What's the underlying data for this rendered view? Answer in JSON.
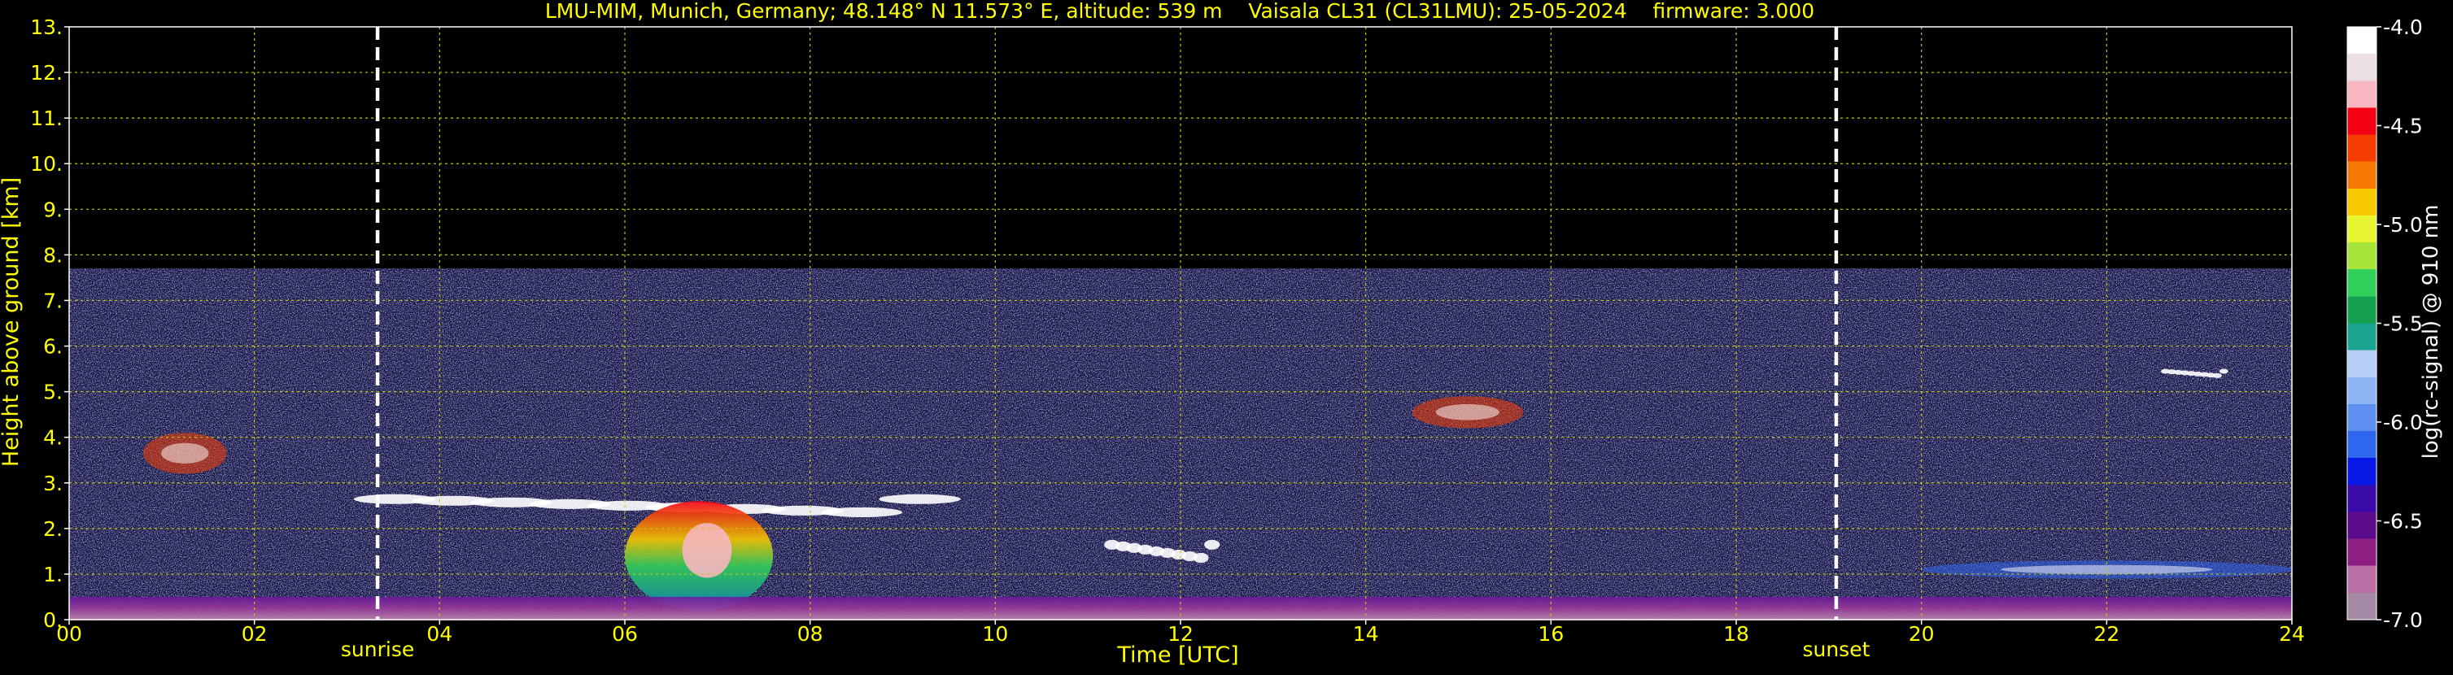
{
  "chart_data": {
    "type": "heatmap",
    "title": "LMU-MIM, Munich, Germany; 48.148° N 11.573° E, altitude: 539 m    Vaisala CL31 (CL31LMU): 25-05-2024    firmware: 3.000",
    "xlabel": "Time [UTC]",
    "ylabel": "Height above ground [km]",
    "xlim": [
      0,
      24
    ],
    "ylim": [
      0,
      13
    ],
    "x_ticks": [
      "00",
      "02",
      "04",
      "06",
      "08",
      "10",
      "12",
      "14",
      "16",
      "18",
      "20",
      "22",
      "24"
    ],
    "y_ticks": [
      "0.",
      "1.",
      "2.",
      "3.",
      "4.",
      "5.",
      "6.",
      "7.",
      "8.",
      "9.",
      "10.",
      "11.",
      "12.",
      "13."
    ],
    "grid": true,
    "max_signal_height_km": 7.7,
    "colorbar": {
      "label": "log(rc-signal) @ 910 nm",
      "vmin": -7.0,
      "vmax": -4.0,
      "ticks": [
        "-4.0",
        "-4.5",
        "-5.0",
        "-5.5",
        "-6.0",
        "-6.5",
        "-7.0"
      ],
      "colors": [
        "#a58aa6",
        "#b96fa3",
        "#8e1f82",
        "#5c0a8c",
        "#3a0aa8",
        "#0818e6",
        "#2f66ee",
        "#5d8ff0",
        "#8eb3f2",
        "#b6cdf5",
        "#1aa38f",
        "#14a04f",
        "#2fcf5a",
        "#a6e43a",
        "#e7f533",
        "#f5c800",
        "#f57800",
        "#f53c00",
        "#f50012",
        "#f7b6c0",
        "#ecdfe3",
        "#ffffff"
      ]
    },
    "vertical_markers": [
      {
        "label": "sunrise",
        "x": 3.33
      },
      {
        "label": "sunset",
        "x": 19.08
      }
    ],
    "features": [
      {
        "kind": "cloud-layer",
        "x_range": [
          3.2,
          9.5
        ],
        "height_km": [
          2.2,
          2.8
        ],
        "color": "#ffffff"
      },
      {
        "kind": "convective-plume",
        "x_range": [
          6.0,
          7.6
        ],
        "height_km": [
          0.2,
          2.6
        ],
        "color": "#f50012"
      },
      {
        "kind": "aerosol-patch",
        "x_range": [
          0.8,
          1.7
        ],
        "height_km": [
          3.2,
          4.1
        ],
        "color": "#f53c00"
      },
      {
        "kind": "aerosol-patch",
        "x_range": [
          14.5,
          15.7
        ],
        "height_km": [
          4.2,
          4.9
        ],
        "color": "#f53c00"
      },
      {
        "kind": "cloud-layer",
        "x_range": [
          11.2,
          12.4
        ],
        "height_km": [
          1.2,
          1.8
        ],
        "color": "#ffffff"
      },
      {
        "kind": "cloud-layer",
        "x_range": [
          22.6,
          23.3
        ],
        "height_km": [
          5.3,
          5.5
        ],
        "color": "#ffffff"
      },
      {
        "kind": "boundary-layer",
        "x_range": [
          0,
          24
        ],
        "height_km": [
          0,
          0.5
        ],
        "color": "#8e1f82"
      },
      {
        "kind": "blue-layer",
        "x_range": [
          20.0,
          24.0
        ],
        "height_km": [
          0.9,
          1.3
        ],
        "color": "#2f66ee"
      }
    ]
  },
  "colors": {
    "text": "#ffff00",
    "grid": "#c8c800",
    "background": "#000000",
    "marker": "#ffffff"
  }
}
